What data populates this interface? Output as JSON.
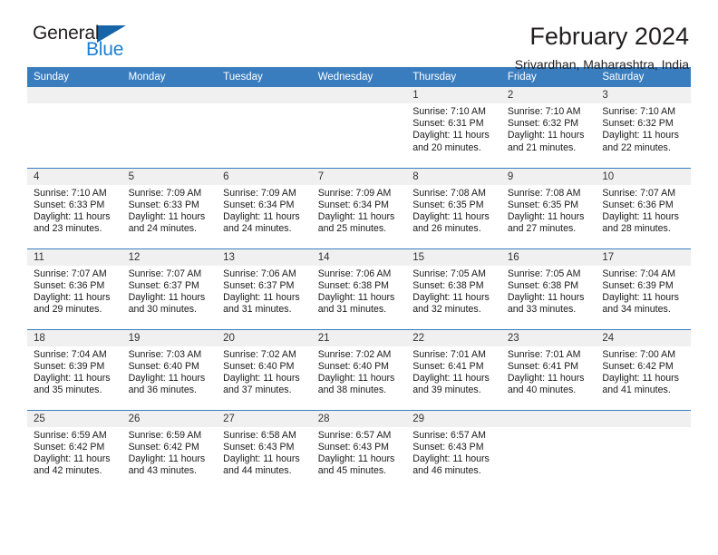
{
  "brand": {
    "name_top": "General",
    "name_bottom": "Blue",
    "triangle_color": "#1565a8",
    "blue_text_color": "#1b7fd4"
  },
  "header": {
    "title": "February 2024",
    "subtitle": "Srivardhan, Maharashtra, India"
  },
  "calendar": {
    "header_bg": "#3a7dbf",
    "daynum_bg": "#f0f0f0",
    "weekday_headers": [
      "Sunday",
      "Monday",
      "Tuesday",
      "Wednesday",
      "Thursday",
      "Friday",
      "Saturday"
    ],
    "weeks": [
      [
        {
          "day": "",
          "empty": true
        },
        {
          "day": "",
          "empty": true
        },
        {
          "day": "",
          "empty": true
        },
        {
          "day": "",
          "empty": true
        },
        {
          "day": "1",
          "sunrise": "Sunrise: 7:10 AM",
          "sunset": "Sunset: 6:31 PM",
          "daylight": "Daylight: 11 hours and 20 minutes."
        },
        {
          "day": "2",
          "sunrise": "Sunrise: 7:10 AM",
          "sunset": "Sunset: 6:32 PM",
          "daylight": "Daylight: 11 hours and 21 minutes."
        },
        {
          "day": "3",
          "sunrise": "Sunrise: 7:10 AM",
          "sunset": "Sunset: 6:32 PM",
          "daylight": "Daylight: 11 hours and 22 minutes."
        }
      ],
      [
        {
          "day": "4",
          "sunrise": "Sunrise: 7:10 AM",
          "sunset": "Sunset: 6:33 PM",
          "daylight": "Daylight: 11 hours and 23 minutes."
        },
        {
          "day": "5",
          "sunrise": "Sunrise: 7:09 AM",
          "sunset": "Sunset: 6:33 PM",
          "daylight": "Daylight: 11 hours and 24 minutes."
        },
        {
          "day": "6",
          "sunrise": "Sunrise: 7:09 AM",
          "sunset": "Sunset: 6:34 PM",
          "daylight": "Daylight: 11 hours and 24 minutes."
        },
        {
          "day": "7",
          "sunrise": "Sunrise: 7:09 AM",
          "sunset": "Sunset: 6:34 PM",
          "daylight": "Daylight: 11 hours and 25 minutes."
        },
        {
          "day": "8",
          "sunrise": "Sunrise: 7:08 AM",
          "sunset": "Sunset: 6:35 PM",
          "daylight": "Daylight: 11 hours and 26 minutes."
        },
        {
          "day": "9",
          "sunrise": "Sunrise: 7:08 AM",
          "sunset": "Sunset: 6:35 PM",
          "daylight": "Daylight: 11 hours and 27 minutes."
        },
        {
          "day": "10",
          "sunrise": "Sunrise: 7:07 AM",
          "sunset": "Sunset: 6:36 PM",
          "daylight": "Daylight: 11 hours and 28 minutes."
        }
      ],
      [
        {
          "day": "11",
          "sunrise": "Sunrise: 7:07 AM",
          "sunset": "Sunset: 6:36 PM",
          "daylight": "Daylight: 11 hours and 29 minutes."
        },
        {
          "day": "12",
          "sunrise": "Sunrise: 7:07 AM",
          "sunset": "Sunset: 6:37 PM",
          "daylight": "Daylight: 11 hours and 30 minutes."
        },
        {
          "day": "13",
          "sunrise": "Sunrise: 7:06 AM",
          "sunset": "Sunset: 6:37 PM",
          "daylight": "Daylight: 11 hours and 31 minutes."
        },
        {
          "day": "14",
          "sunrise": "Sunrise: 7:06 AM",
          "sunset": "Sunset: 6:38 PM",
          "daylight": "Daylight: 11 hours and 31 minutes."
        },
        {
          "day": "15",
          "sunrise": "Sunrise: 7:05 AM",
          "sunset": "Sunset: 6:38 PM",
          "daylight": "Daylight: 11 hours and 32 minutes."
        },
        {
          "day": "16",
          "sunrise": "Sunrise: 7:05 AM",
          "sunset": "Sunset: 6:38 PM",
          "daylight": "Daylight: 11 hours and 33 minutes."
        },
        {
          "day": "17",
          "sunrise": "Sunrise: 7:04 AM",
          "sunset": "Sunset: 6:39 PM",
          "daylight": "Daylight: 11 hours and 34 minutes."
        }
      ],
      [
        {
          "day": "18",
          "sunrise": "Sunrise: 7:04 AM",
          "sunset": "Sunset: 6:39 PM",
          "daylight": "Daylight: 11 hours and 35 minutes."
        },
        {
          "day": "19",
          "sunrise": "Sunrise: 7:03 AM",
          "sunset": "Sunset: 6:40 PM",
          "daylight": "Daylight: 11 hours and 36 minutes."
        },
        {
          "day": "20",
          "sunrise": "Sunrise: 7:02 AM",
          "sunset": "Sunset: 6:40 PM",
          "daylight": "Daylight: 11 hours and 37 minutes."
        },
        {
          "day": "21",
          "sunrise": "Sunrise: 7:02 AM",
          "sunset": "Sunset: 6:40 PM",
          "daylight": "Daylight: 11 hours and 38 minutes."
        },
        {
          "day": "22",
          "sunrise": "Sunrise: 7:01 AM",
          "sunset": "Sunset: 6:41 PM",
          "daylight": "Daylight: 11 hours and 39 minutes."
        },
        {
          "day": "23",
          "sunrise": "Sunrise: 7:01 AM",
          "sunset": "Sunset: 6:41 PM",
          "daylight": "Daylight: 11 hours and 40 minutes."
        },
        {
          "day": "24",
          "sunrise": "Sunrise: 7:00 AM",
          "sunset": "Sunset: 6:42 PM",
          "daylight": "Daylight: 11 hours and 41 minutes."
        }
      ],
      [
        {
          "day": "25",
          "sunrise": "Sunrise: 6:59 AM",
          "sunset": "Sunset: 6:42 PM",
          "daylight": "Daylight: 11 hours and 42 minutes."
        },
        {
          "day": "26",
          "sunrise": "Sunrise: 6:59 AM",
          "sunset": "Sunset: 6:42 PM",
          "daylight": "Daylight: 11 hours and 43 minutes."
        },
        {
          "day": "27",
          "sunrise": "Sunrise: 6:58 AM",
          "sunset": "Sunset: 6:43 PM",
          "daylight": "Daylight: 11 hours and 44 minutes."
        },
        {
          "day": "28",
          "sunrise": "Sunrise: 6:57 AM",
          "sunset": "Sunset: 6:43 PM",
          "daylight": "Daylight: 11 hours and 45 minutes."
        },
        {
          "day": "29",
          "sunrise": "Sunrise: 6:57 AM",
          "sunset": "Sunset: 6:43 PM",
          "daylight": "Daylight: 11 hours and 46 minutes."
        },
        {
          "day": "",
          "empty": true
        },
        {
          "day": "",
          "empty": true
        }
      ]
    ]
  }
}
